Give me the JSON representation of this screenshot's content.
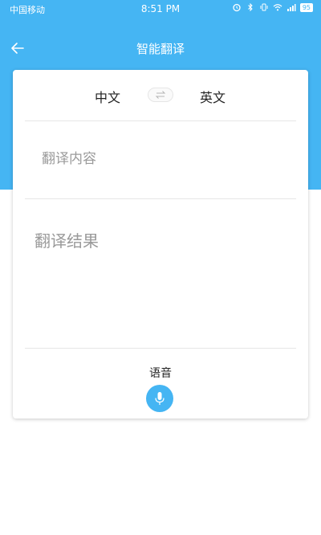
{
  "status_bar": {
    "carrier": "中国移动",
    "time": "8:51 PM",
    "battery": "95"
  },
  "header": {
    "back_icon": "arrow-left-icon",
    "title": "智能翻译"
  },
  "languages": {
    "source": "中文",
    "target": "英文",
    "swap_icon": "swap-arrows-icon"
  },
  "input": {
    "placeholder": "翻译内容"
  },
  "result": {
    "placeholder": "翻译结果"
  },
  "voice": {
    "label": "语音",
    "icon": "microphone-icon"
  },
  "colors": {
    "accent": "#45b5f3",
    "text": "#222222",
    "placeholder": "#9a9a9a"
  }
}
